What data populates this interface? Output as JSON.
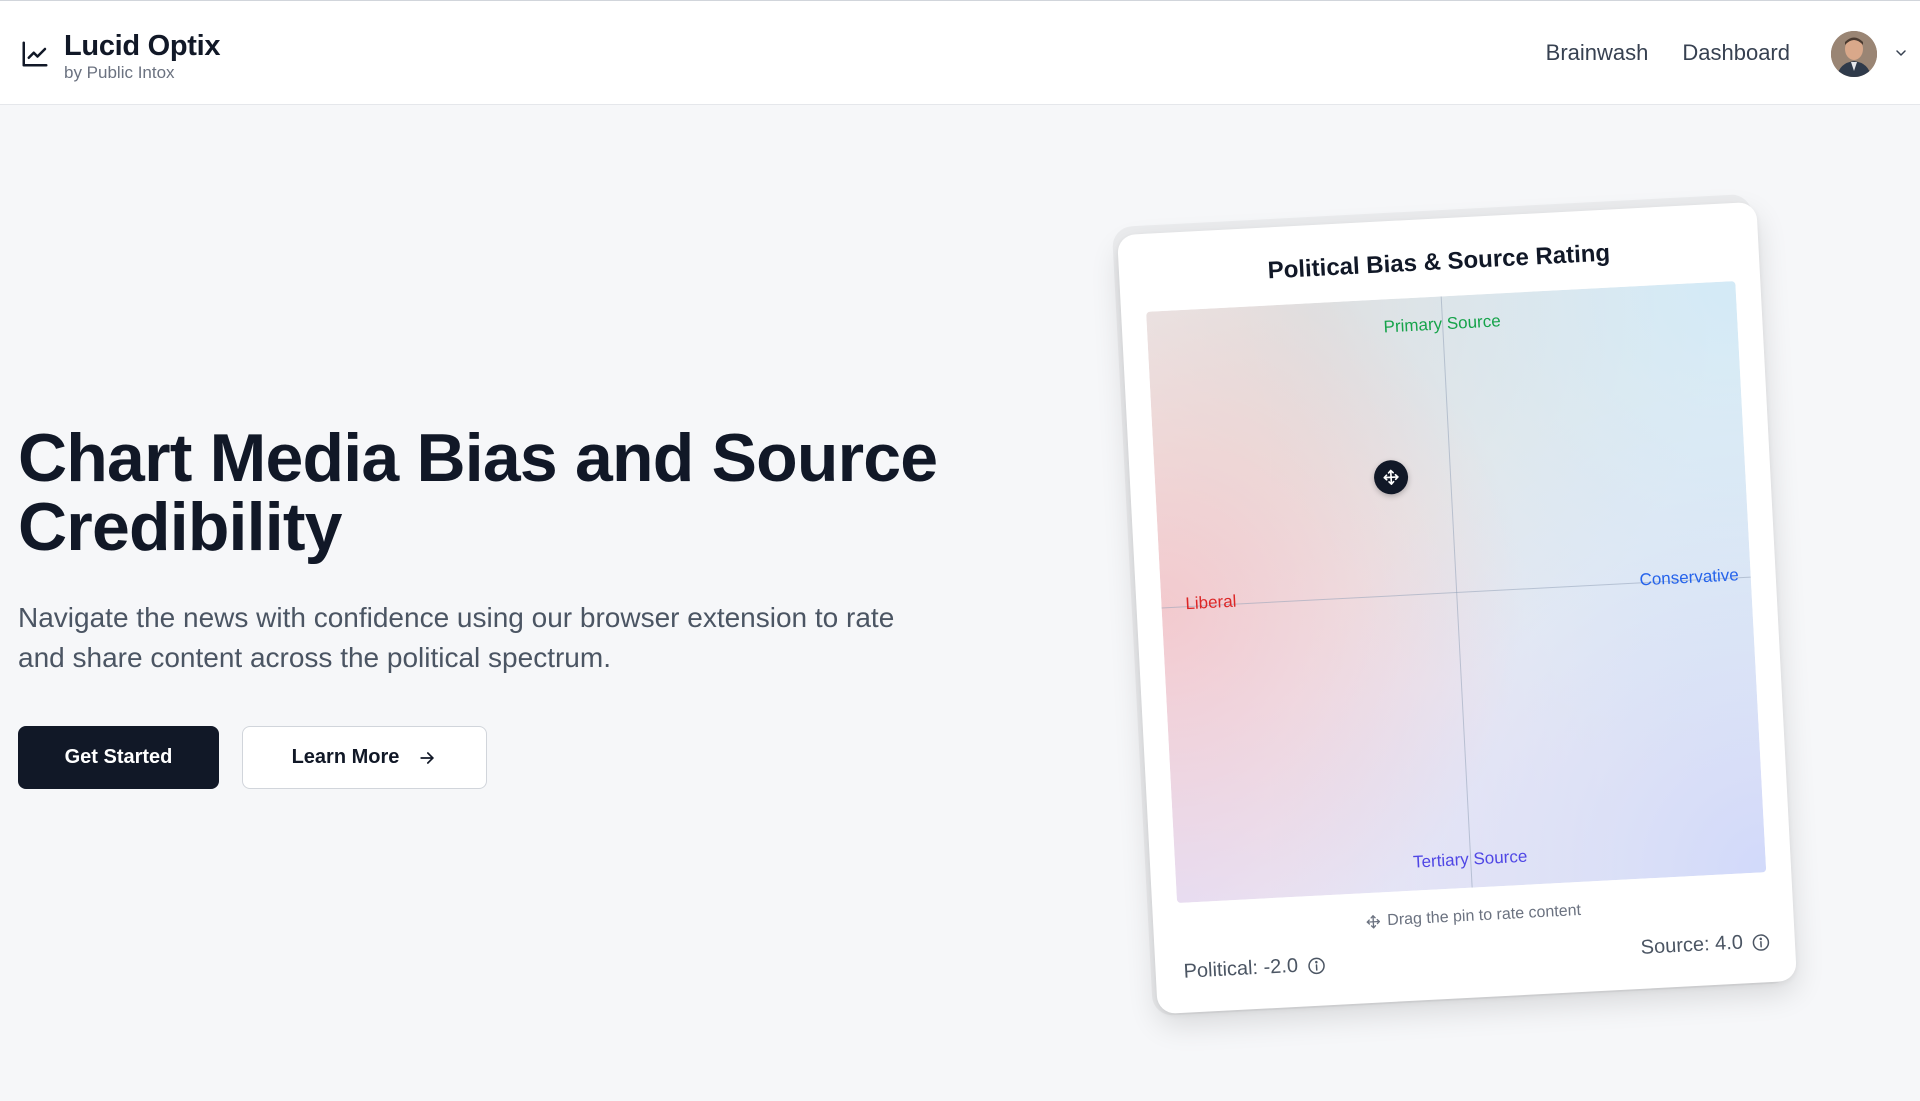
{
  "header": {
    "brand_name": "Lucid Optix",
    "brand_sub": "by Public Intox",
    "nav": [
      {
        "label": "Brainwash"
      },
      {
        "label": "Dashboard"
      }
    ]
  },
  "hero": {
    "title": "Chart Media Bias and Source Credibility",
    "subtitle": "Navigate the news with confidence using our browser extension to rate and share content across the political spectrum.",
    "primary_cta": "Get Started",
    "secondary_cta": "Learn More"
  },
  "rating_card": {
    "title": "Political Bias & Source Rating",
    "labels": {
      "top": "Primary Source",
      "bottom": "Tertiary Source",
      "left": "Liberal",
      "right": "Conservative"
    },
    "hint": "Drag the pin to rate content",
    "political_readout": "Political: -2.0",
    "source_readout": "Source: 4.0",
    "political_value": -2.0,
    "source_value": 4.0,
    "axis_range": [
      -10,
      10
    ],
    "colors": {
      "liberal": "#dc2626",
      "conservative": "#2563eb",
      "primary": "#16a34a",
      "tertiary": "#4f46e5"
    }
  },
  "icons": {
    "brand": "line-chart-icon",
    "arrow": "arrow-right-icon",
    "pin": "move-icon",
    "info": "info-circle-icon",
    "menu": "chevron-down-icon"
  }
}
